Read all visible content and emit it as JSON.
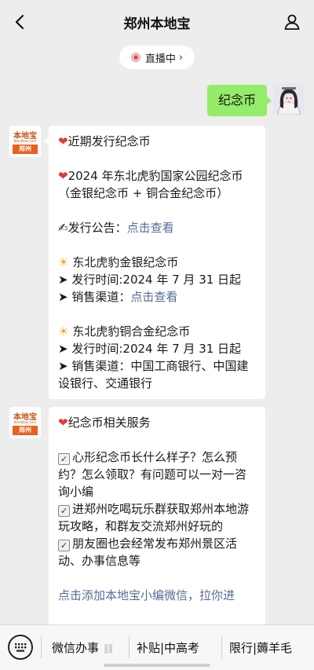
{
  "header": {
    "title": "郑州本地宝"
  },
  "live": {
    "label": "直播中"
  },
  "user_message": {
    "text": "纪念币"
  },
  "bot": {
    "logo_text": "本地宝",
    "logo_sub": "Bendibao.com",
    "logo_city": "郑州"
  },
  "message1": {
    "heading": "近期发行纪念币",
    "item_title": "2024 年东北虎豹国家公园纪念币（金银纪念币 + 铜合金纪念币）",
    "announcement_label": "发行公告：",
    "announcement_link": "点击查看",
    "gold": {
      "title": "东北虎豹金银纪念币",
      "date_line": "发行时间:2024 年 7 月 31 日起",
      "channel_label": "销售渠道：",
      "channel_link": "点击查看"
    },
    "copper": {
      "title": "东北虎豹铜合金纪念币",
      "date_line": "发行时间:2024 年 7 月 31 日起",
      "channel_line": "销售渠道：中国工商银行、中国建设银行、交通银行"
    }
  },
  "message2": {
    "heading": "纪念币相关服务",
    "item1": "心形纪念币长什么样子？怎么预约？怎么领取？有问题可以一对一咨询小编",
    "item2": "进郑州吃喝玩乐群获取郑州本地游玩攻略，和群友交流郑州好玩的",
    "item3": "朋友圈也会经常发布郑州景区活动、办事信息等",
    "link": "点击添加本地宝小编微信，拉你进"
  },
  "bottom_menu": {
    "item1": "微信办事",
    "item2": "补贴|中高考",
    "item3": "限行|薅羊毛"
  },
  "icons": {
    "back": "chevron-left-icon",
    "user": "person-icon",
    "keyboard": "keyboard-icon",
    "heart": "heart-icon",
    "sun": "sun-icon",
    "check": "checkbox-icon",
    "pen": "writing-hand-icon"
  },
  "colors": {
    "background": "#ededed",
    "user_bubble": "#95ec69",
    "link": "#576b95",
    "accent": "#e8611d"
  }
}
